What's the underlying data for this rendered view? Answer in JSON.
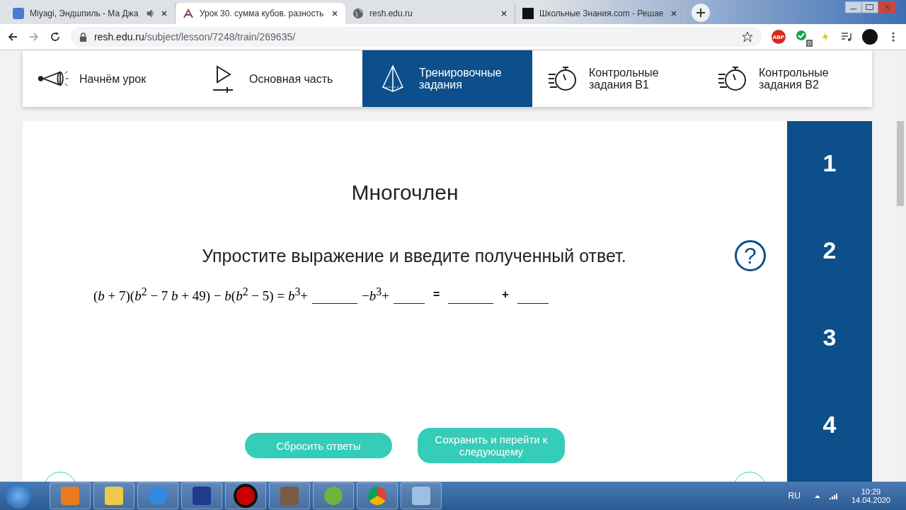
{
  "browser_tabs": [
    {
      "title": "Miyagi, Эндшпиль - Ма Джа",
      "selected": false,
      "kind": "chat"
    },
    {
      "title": "Урок 30. сумма кубов. разность",
      "selected": true,
      "kind": "lesson"
    },
    {
      "title": "resh.edu.ru",
      "selected": false,
      "kind": "globe"
    },
    {
      "title": "Школьные Знания.com - Решае",
      "selected": false,
      "kind": "znania"
    }
  ],
  "address": {
    "host": "resh.edu.ru",
    "path": "/subject/lesson/7248/train/269635/"
  },
  "extensions": [
    {
      "kind": "abp",
      "label": "ABP"
    },
    {
      "kind": "check",
      "label": "0"
    }
  ],
  "lesson_nav": [
    {
      "label": "Начнём урок",
      "kind": "horn",
      "selected": false
    },
    {
      "label": "Основная часть",
      "kind": "play",
      "selected": false
    },
    {
      "label": "Тренировочные задания",
      "kind": "pyramid",
      "selected": true
    },
    {
      "label": "Контрольные задания В1",
      "kind": "timer",
      "selected": false
    },
    {
      "label": "Контрольные задания В2",
      "kind": "timer",
      "selected": false
    }
  ],
  "task": {
    "title": "Многочлен",
    "instruction": "Упростите выражение и введите полученный ответ.",
    "equation": [
      {
        "kind": "math",
        "text": "(*b* + 7)(*b*$^{2}$ − 7 *b* + 49) − *b*(*b*$^{2}$ − 5) = *b*$^{3}$+"
      },
      {
        "kind": "blank",
        "wide": true
      },
      {
        "kind": "math",
        "text": "−*b*$^{3}$+"
      },
      {
        "kind": "blank",
        "wide": false
      },
      {
        "kind": "sign",
        "text": "="
      },
      {
        "kind": "blank",
        "wide": true
      },
      {
        "kind": "sign",
        "text": "+"
      },
      {
        "kind": "blank",
        "wide": false
      }
    ],
    "buttons": [
      "Сбросить ответы",
      "Сохранить и перейти к следующему"
    ]
  },
  "task_numbers": [
    "1",
    "2",
    "3",
    "4"
  ],
  "help": "?",
  "taskbar": {
    "language": "RU",
    "time": "10:29",
    "date": "14.04.2020"
  }
}
